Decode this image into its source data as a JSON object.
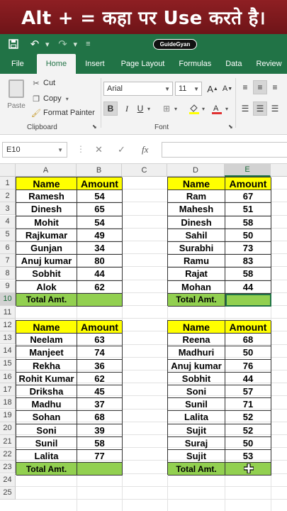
{
  "banner": {
    "text": "Alt + = कहा पर Use करते है।"
  },
  "titlebar": {
    "logo_text": "GuideGyan"
  },
  "tabs": [
    "File",
    "Home",
    "Insert",
    "Page Layout",
    "Formulas",
    "Data",
    "Review"
  ],
  "ribbon": {
    "paste_label": "Paste",
    "cut_label": "Cut",
    "copy_label": "Copy",
    "format_painter_label": "Format Painter",
    "clipboard_label": "Clipboard",
    "font_label": "Font",
    "font_name": "Arial",
    "font_size": "11",
    "bold": "B",
    "italic": "I",
    "underline": "U"
  },
  "formula_bar": {
    "name_box": "E10",
    "fx_label": "fx",
    "formula": ""
  },
  "columns": [
    "A",
    "B",
    "C",
    "D",
    "E"
  ],
  "rows": [
    "1",
    "2",
    "3",
    "4",
    "5",
    "6",
    "7",
    "8",
    "9",
    "10",
    "11",
    "12",
    "13",
    "14",
    "15",
    "16",
    "17",
    "18",
    "19",
    "20",
    "21",
    "22",
    "23",
    "24",
    "25"
  ],
  "colors": {
    "excel_green": "#217346",
    "header_yellow": "#ffff00",
    "total_green": "#92d050",
    "banner_red": "#8e1f23"
  },
  "tables": {
    "t1": {
      "headers": [
        "Name",
        "Amount"
      ],
      "rows": [
        [
          "Ramesh",
          "54"
        ],
        [
          "Dinesh",
          "65"
        ],
        [
          "Mohit",
          "54"
        ],
        [
          "Rajkumar",
          "49"
        ],
        [
          "Gunjan",
          "34"
        ],
        [
          "Anuj kumar",
          "80"
        ],
        [
          "Sobhit",
          "44"
        ],
        [
          "Alok",
          "62"
        ]
      ],
      "total_label": "Total Amt.",
      "total_value": ""
    },
    "t2": {
      "headers": [
        "Name",
        "Amount"
      ],
      "rows": [
        [
          "Ram",
          "67"
        ],
        [
          "Mahesh",
          "51"
        ],
        [
          "Dinesh",
          "58"
        ],
        [
          "Sahil",
          "50"
        ],
        [
          "Surabhi",
          "73"
        ],
        [
          "Ramu",
          "83"
        ],
        [
          "Rajat",
          "58"
        ],
        [
          "Mohan",
          "44"
        ]
      ],
      "total_label": "Total Amt.",
      "total_value": ""
    },
    "t3": {
      "headers": [
        "Name",
        "Amount"
      ],
      "rows": [
        [
          "Neelam",
          "63"
        ],
        [
          "Manjeet",
          "74"
        ],
        [
          "Rekha",
          "36"
        ],
        [
          "Rohit Kumar",
          "62"
        ],
        [
          "Driksha",
          "45"
        ],
        [
          "Madhu",
          "37"
        ],
        [
          "Sohan",
          "68"
        ],
        [
          "Soni",
          "39"
        ],
        [
          "Sunil",
          "58"
        ],
        [
          "Lalita",
          "77"
        ]
      ],
      "total_label": "Total Amt.",
      "total_value": ""
    },
    "t4": {
      "headers": [
        "Name",
        "Amount"
      ],
      "rows": [
        [
          "Reena",
          "68"
        ],
        [
          "Madhuri",
          "50"
        ],
        [
          "Anuj kumar",
          "76"
        ],
        [
          "Sobhit",
          "44"
        ],
        [
          "Soni",
          "57"
        ],
        [
          "Sunil",
          "71"
        ],
        [
          "Lalita",
          "52"
        ],
        [
          "Sujit",
          "52"
        ],
        [
          "Suraj",
          "50"
        ],
        [
          "Sujit",
          "53"
        ]
      ],
      "total_label": "Total Amt.",
      "total_value": ""
    }
  }
}
